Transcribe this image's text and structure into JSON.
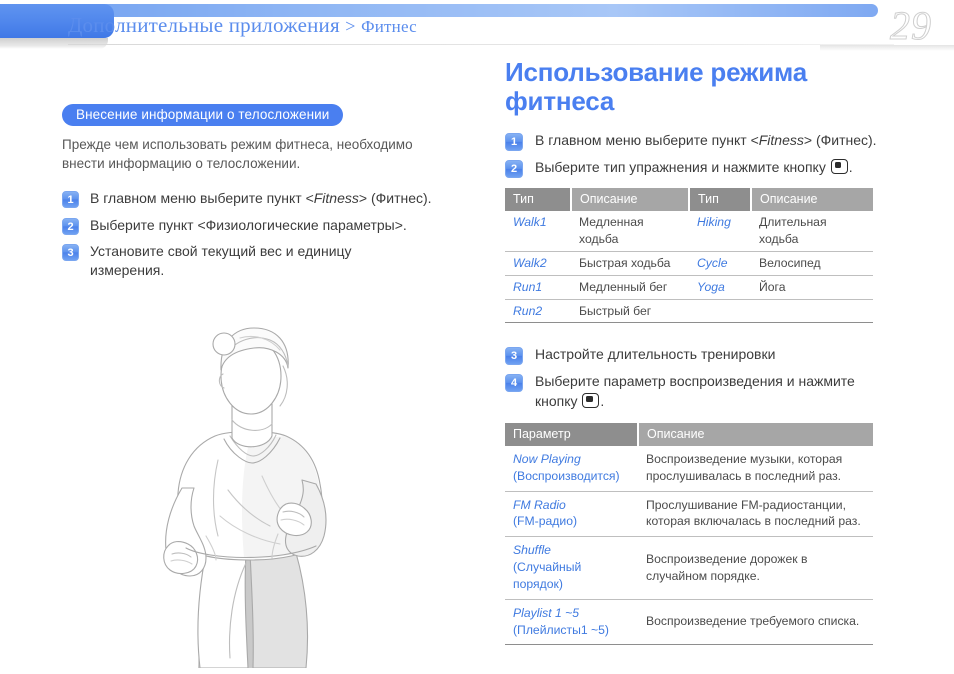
{
  "header": {
    "breadcrumb_main": "Дополнительные приложения",
    "breadcrumb_sep": ">",
    "breadcrumb_sub": "Фитнес",
    "page_number": "29",
    "accent_color": "#4a7ff0",
    "bar_color": "#8fb6f4"
  },
  "left": {
    "section_label": "Внесение информации о телосложении",
    "intro": "Прежде чем использовать режим фитнеса, необходимо внести информацию о телосложении.",
    "steps": [
      {
        "num": "1",
        "text_a": "В главном меню выберите пункт <",
        "term": "Fitness",
        "text_b": "> (Фитнес)."
      },
      {
        "num": "2",
        "text_a": "Выберите пункт <Физиологические параметры>.",
        "term": "",
        "text_b": ""
      },
      {
        "num": "3",
        "text_a": "Установите свой текущий вес и единицу измерения.",
        "term": "",
        "text_b": ""
      }
    ],
    "illustration_alt": "Иллюстрация: бегущая женщина"
  },
  "right": {
    "title": "Использование режима фитнеса",
    "steps": [
      {
        "num": "1",
        "text_a": "В главном меню выберите пункт <",
        "term": "Fitness",
        "text_b": "> (Фитнес)."
      },
      {
        "num": "2",
        "text_a": "Выберите тип упражнения и нажмите кнопку ",
        "term": "",
        "text_b": "."
      },
      {
        "num": "3",
        "text_a": "Настройте длительность тренировки",
        "term": "",
        "text_b": ""
      },
      {
        "num": "4",
        "text_a": "Выберите параметр воспроизведения и нажмите кнопку ",
        "term": "",
        "text_b": "."
      }
    ],
    "table_types": {
      "headers": [
        "Тип",
        "Описание",
        "Тип",
        "Описание"
      ],
      "rows": [
        {
          "type1": "Walk1",
          "desc1": "Медленная ходьба",
          "type2": "Hiking",
          "desc2": "Длительная ходьба"
        },
        {
          "type1": "Walk2",
          "desc1": "Быстрая ходьба",
          "type2": "Cycle",
          "desc2": "Велосипед"
        },
        {
          "type1": "Run1",
          "desc1": "Медленный бег",
          "type2": "Yoga",
          "desc2": "Йога"
        },
        {
          "type1": "Run2",
          "desc1": "Быстрый бег",
          "type2": "",
          "desc2": ""
        }
      ]
    },
    "table_params": {
      "headers": [
        "Параметр",
        "Описание"
      ],
      "rows": [
        {
          "term": "Now Playing",
          "term_ru": "(Воспроизводится)",
          "desc": "Воспроизведение музыки, которая прослушивалась в последний раз."
        },
        {
          "term": "FM Radio",
          "term_ru": "(FM-радио)",
          "desc": "Прослушивание FM-радиостанции, которая включалась в последний раз."
        },
        {
          "term": "Shuffle",
          "term_ru": "(Случайный порядок)",
          "desc": "Воспроизведение дорожек в случайном порядке."
        },
        {
          "term": "Playlist 1 ~5",
          "term_ru": "(Плейлисты1 ~5)",
          "desc": "Воспроизведение требуемого списка."
        }
      ]
    }
  },
  "icons": {
    "ok_key": "ok-key-icon"
  }
}
